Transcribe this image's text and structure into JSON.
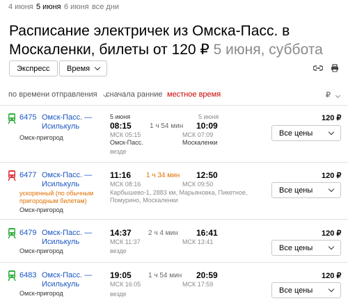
{
  "date_tabs": [
    {
      "label": "4 июня"
    },
    {
      "label": "5 июня"
    },
    {
      "label": "6 июня"
    },
    {
      "label": "все дни"
    }
  ],
  "title": {
    "main": "Расписание электричек из Омска-Пасс. в Москаленки, билеты от 120 ₽",
    "sub": "5 июня, суббота"
  },
  "filters": {
    "express_label": "Экспресс",
    "time_label": "Время"
  },
  "sort": {
    "by_departure": "по времени отправления",
    "earliest_first": "сначала ранние",
    "local_time": "местное время",
    "currency": "₽"
  },
  "colors": {
    "green_train": "#2fae3a",
    "red_train": "#e0323c",
    "link": "#1a56c4",
    "accent_red": "#cc0000",
    "orange": "#e07000"
  },
  "trains": [
    {
      "icon": "green-train-icon",
      "number": "6475",
      "route": "Омск-Пасс. — Исилькуль",
      "note": "",
      "category": "Омск-пригород",
      "dep_date": "5 июня",
      "dep_time": "08:15",
      "duration": "1 ч 54 мин",
      "arr_date": "5 июня",
      "arr_time": "10:09",
      "dep_msk": "МСК 05:15",
      "arr_msk": "МСК 07:09",
      "dep_station": "Омск-Пасс.",
      "arr_station": "Москаленки",
      "stops": "везде",
      "price": "120 ₽",
      "select_label": "Все цены"
    },
    {
      "icon": "red-train-icon",
      "number": "6477",
      "route": "Омск-Пасс. — Исилькуль",
      "note": "ускоренный (по обычным пригородным билетам)",
      "category": "Омск-пригород",
      "dep_date": "",
      "dep_time": "11:16",
      "duration": "1 ч 34 мин",
      "arr_date": "",
      "arr_time": "12:50",
      "dep_msk": "МСК 08:16",
      "arr_msk": "МСК 09:50",
      "dep_station": "",
      "arr_station": "",
      "stops": "Карбышево-1, 2883 км, Марьяновка, Пикетное, Помурино, Москаленки",
      "price": "120 ₽",
      "select_label": "Все цены"
    },
    {
      "icon": "green-train-icon",
      "number": "6479",
      "route": "Омск-Пасс. — Исилькуль",
      "note": "",
      "category": "Омск-пригород",
      "dep_date": "",
      "dep_time": "14:37",
      "duration": "2 ч 4 мин",
      "arr_date": "",
      "arr_time": "16:41",
      "dep_msk": "МСК 11:37",
      "arr_msk": "МСК 13:41",
      "dep_station": "",
      "arr_station": "",
      "stops": "везде",
      "price": "120 ₽",
      "select_label": "Все цены"
    },
    {
      "icon": "green-train-icon",
      "number": "6483",
      "route": "Омск-Пасс. — Исилькуль",
      "note": "",
      "category": "Омск-пригород",
      "dep_date": "",
      "dep_time": "19:05",
      "duration": "1 ч 54 мин",
      "arr_date": "",
      "arr_time": "20:59",
      "dep_msk": "МСК 16:05",
      "arr_msk": "МСК 17:59",
      "dep_station": "",
      "arr_station": "",
      "stops": "везде",
      "price": "120 ₽",
      "select_label": "Все цены"
    }
  ]
}
